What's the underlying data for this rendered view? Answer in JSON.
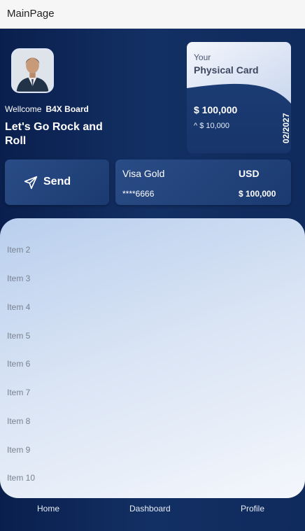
{
  "window": {
    "title": "MainPage"
  },
  "profile": {
    "greeting": "Wellcome",
    "name": "B4X Board",
    "tagline": "Let's Go Rock and Roll"
  },
  "physical_card": {
    "label_your": "Your",
    "label_title": "Physical Card",
    "amount": "$ 100,000",
    "sub_amount": "^ $ 10,000",
    "expiry": "02/2027"
  },
  "send_button": {
    "label": "Send",
    "icon": "send-icon"
  },
  "visa_card": {
    "name": "Visa Gold",
    "currency": "USD",
    "number": "****6666",
    "balance": "$ 100,000"
  },
  "list": {
    "items": [
      "Item 2",
      "Item 3",
      "Item 4",
      "Item 5",
      "Item 6",
      "Item 7",
      "Item 8",
      "Item 9",
      "Item 10"
    ]
  },
  "bottom_nav": {
    "home": "Home",
    "dashboard": "Dashboard",
    "profile": "Profile"
  },
  "colors": {
    "background": "#0f2a5c",
    "card": "#1d3f79",
    "panel_light": "#d8e3f4"
  }
}
